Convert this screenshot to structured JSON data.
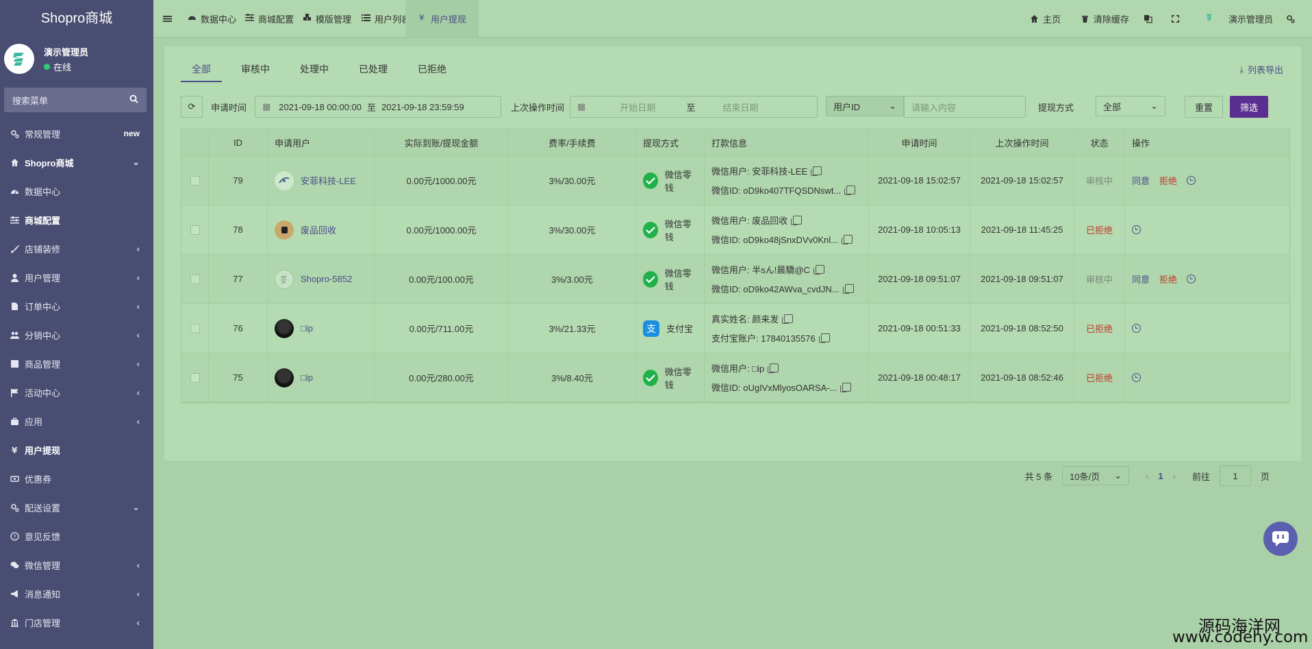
{
  "sidebar": {
    "brand": "Shopro商城",
    "admin_name": "演示管理员",
    "admin_status": "在线",
    "search_placeholder": "搜索菜单",
    "items": [
      {
        "label": "常规管理",
        "icon": "gears-icon",
        "badge": "new",
        "bold": false
      },
      {
        "label": "Shopro商城",
        "icon": "home-icon",
        "arrow": "⌄",
        "bold": true
      },
      {
        "label": "数据中心",
        "icon": "dashboard-icon",
        "bold": false
      },
      {
        "label": "商城配置",
        "icon": "sliders-icon",
        "bold": true
      },
      {
        "label": "店铺装修",
        "icon": "brush-icon",
        "arrow": "‹",
        "bold": false
      },
      {
        "label": "用户管理",
        "icon": "user-icon",
        "arrow": "‹",
        "bold": false
      },
      {
        "label": "订单中心",
        "icon": "file-icon",
        "arrow": "‹",
        "bold": false
      },
      {
        "label": "分销中心",
        "icon": "users-icon",
        "arrow": "‹",
        "bold": false
      },
      {
        "label": "商品管理",
        "icon": "box-icon",
        "arrow": "‹",
        "bold": false
      },
      {
        "label": "活动中心",
        "icon": "flag-icon",
        "arrow": "‹",
        "bold": false
      },
      {
        "label": "应用",
        "icon": "briefcase-icon",
        "arrow": "‹",
        "bold": false
      },
      {
        "label": "用户提现",
        "icon": "yen-icon",
        "bold": true
      },
      {
        "label": "优惠券",
        "icon": "ticket-icon",
        "bold": false
      },
      {
        "label": "配送设置",
        "icon": "gears-icon",
        "arrow": "⌄",
        "bold": false
      },
      {
        "label": "意见反馈",
        "icon": "question-icon",
        "bold": false
      },
      {
        "label": "微信管理",
        "icon": "wechat-icon",
        "arrow": "‹",
        "bold": false
      },
      {
        "label": "消息通知",
        "icon": "bullhorn-icon",
        "arrow": "‹",
        "bold": false
      },
      {
        "label": "门店管理",
        "icon": "bank-icon",
        "arrow": "‹",
        "bold": false
      }
    ]
  },
  "topbar": {
    "menu_icon": "hamburger-icon",
    "tabs": [
      {
        "label": "数据中心",
        "icon": "dashboard-icon"
      },
      {
        "label": "商城配置",
        "icon": "sliders-icon"
      },
      {
        "label": "模版管理",
        "icon": "cubes-icon"
      },
      {
        "label": "用户列表",
        "icon": "list-icon"
      },
      {
        "label": "用户提现",
        "icon": "yen-icon",
        "active": true
      }
    ],
    "right": [
      {
        "label": "主页",
        "icon": "home-icon"
      },
      {
        "label": "清除缓存",
        "icon": "trash-icon"
      },
      {
        "label": "",
        "icon": "translate-icon"
      },
      {
        "label": "",
        "icon": "fullscreen-icon"
      },
      {
        "label": "演示管理员",
        "icon": "logo-icon"
      },
      {
        "label": "",
        "icon": "gears-icon"
      }
    ]
  },
  "content": {
    "tabs": [
      "全部",
      "审核中",
      "处理中",
      "已处理",
      "已拒绝"
    ],
    "active_tab": 0,
    "export_label": "列表导出",
    "filters": {
      "apply_time_label": "申请时间",
      "apply_start": "2021-09-18 00:00:00",
      "apply_to": "至",
      "apply_end": "2021-09-18 23:59:59",
      "last_op_label": "上次操作时间",
      "last_op_start_placeholder": "开始日期",
      "last_op_to": "至",
      "last_op_end_placeholder": "结束日期",
      "user_field_select": "用户ID",
      "user_input_placeholder": "请输入内容",
      "method_label": "提现方式",
      "method_value": "全部",
      "reset_label": "重置",
      "filter_label": "筛选"
    },
    "table": {
      "headers": [
        "",
        "ID",
        "申请用户",
        "实际到账/提现金额",
        "费率/手续费",
        "提现方式",
        "打款信息",
        "申请时间",
        "上次操作时间",
        "状态",
        "操作"
      ],
      "rows": [
        {
          "id": "79",
          "user": "安菲科技-LEE",
          "avatar": "avatar-logo-lee",
          "amount": "0.00元/1000.00元",
          "fee": "3%/30.00元",
          "method": "微信零钱",
          "method_icon": "wechat-icon",
          "info1": "微信用户: 安菲科技-LEE",
          "info2": "微信ID: oD9ko407TFQSDNswt...",
          "apply_time": "2021-09-18 15:02:57",
          "last_time": "2021-09-18 15:02:57",
          "status": "审核中",
          "status_type": "pending",
          "agree": "同意",
          "refuse": "拒绝"
        },
        {
          "id": "78",
          "user": "废品回收",
          "avatar": "avatar-recycle",
          "amount": "0.00元/1000.00元",
          "fee": "3%/30.00元",
          "method": "微信零钱",
          "method_icon": "wechat-icon",
          "info1": "微信用户: 废品回收",
          "info2": "微信ID: oD9ko48jSnxDVv0Knl...",
          "apply_time": "2021-09-18 10:05:13",
          "last_time": "2021-09-18 11:45:25",
          "status": "已拒绝",
          "status_type": "rejected"
        },
        {
          "id": "77",
          "user": "Shopro-5852",
          "avatar": "avatar-shopro",
          "amount": "0.00元/100.00元",
          "fee": "3%/3.00元",
          "method": "微信零钱",
          "method_icon": "wechat-icon",
          "info1": "微信用户: 半sん!晨驕@C",
          "info2": "微信ID: oD9ko42AWva_cvdJN...",
          "apply_time": "2021-09-18 09:51:07",
          "last_time": "2021-09-18 09:51:07",
          "status": "审核中",
          "status_type": "pending",
          "agree": "同意",
          "refuse": "拒绝"
        },
        {
          "id": "76",
          "user": "□ip",
          "avatar": "avatar-dark",
          "amount": "0.00元/711.00元",
          "fee": "3%/21.33元",
          "method": "支付宝",
          "method_icon": "alipay-icon",
          "info1": "真实姓名: 颜来发",
          "info2": "支付宝账户: 17840135576",
          "apply_time": "2021-09-18 00:51:33",
          "last_time": "2021-09-18 08:52:50",
          "status": "已拒绝",
          "status_type": "rejected"
        },
        {
          "id": "75",
          "user": "□ip",
          "avatar": "avatar-dark",
          "amount": "0.00元/280.00元",
          "fee": "3%/8.40元",
          "method": "微信零钱",
          "method_icon": "wechat-icon",
          "info1": "微信用户: □ip",
          "info2": "微信ID: oUgIVxMlyosOARSA-...",
          "apply_time": "2021-09-18 00:48:17",
          "last_time": "2021-09-18 08:52:46",
          "status": "已拒绝",
          "status_type": "rejected"
        }
      ]
    },
    "pagination": {
      "total": "共 5 条",
      "page_size": "10条/页",
      "current": "1",
      "goto_label": "前往",
      "goto_value": "1",
      "page_suffix": "页"
    }
  },
  "watermark": {
    "line1": "源码海洋网",
    "line2": "www.codehy.com"
  },
  "colors": {
    "sidebar": "#4a4d72",
    "accent": "#5b2f8f",
    "link": "#4a4d8a",
    "rejected": "#c0392b",
    "page_bg": "#a9d0a7"
  }
}
